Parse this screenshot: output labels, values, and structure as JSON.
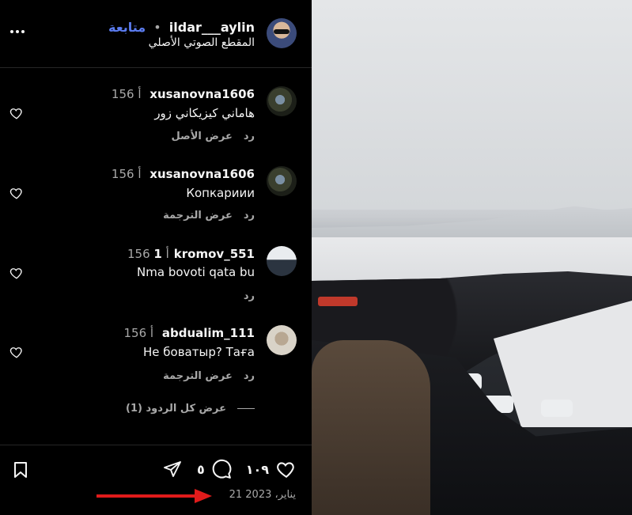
{
  "post": {
    "username": "ildar___aylin",
    "separator": "•",
    "follow_label": "متابعة",
    "audio_label": "المقطع الصوتي الأصلي"
  },
  "comments": [
    {
      "username": "xusanovna1606",
      "time": "156 أ",
      "text": "هاماني كيزيكاني زور",
      "reply_label": "رد",
      "secondary_label": "عرض الأصل"
    },
    {
      "username": "xusanovna1606",
      "time": "156 أ",
      "text": "Копкариии",
      "reply_label": "رد",
      "secondary_label": "عرض الترجمة"
    },
    {
      "username": "1kromov_551",
      "time": "156 أ",
      "text": "Nma bovoti qata bu",
      "reply_label": "رد"
    },
    {
      "username": "abdualim_111",
      "time": "156 أ",
      "text": "Не боватыр? Таға",
      "reply_label": "رد",
      "secondary_label": "عرض الترجمة"
    }
  ],
  "view_replies_label": "عرض كل الردود (1)",
  "footer": {
    "likes_count": "١٠٩",
    "comments_count": "٥",
    "date": "21 يناير، 2023"
  },
  "icons": {
    "more": "more-options-icon",
    "heart": "heart-icon",
    "comment": "comment-icon",
    "share": "share-icon",
    "bookmark": "bookmark-icon",
    "annotation": "red-arrow-icon"
  },
  "colors": {
    "accent_follow": "#5b7cf0",
    "annotation_arrow": "#e01b1b",
    "muted_text": "#a8a8a8"
  }
}
